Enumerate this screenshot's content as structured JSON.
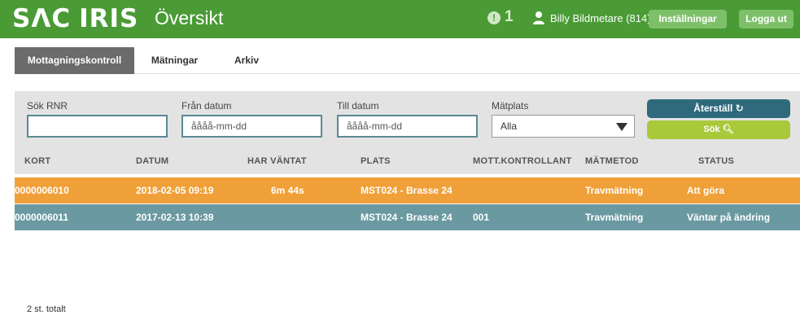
{
  "header": {
    "logo_left": "SΛC",
    "logo_right": "IRIS",
    "title": "Översikt",
    "alert_count": "1",
    "user_name": "Billy Bildmetare (814)",
    "settings_label": "Inställningar",
    "logout_label": "Logga ut",
    "colors": {
      "header_bg": "#4a9b36",
      "header_button": "#7ec06a"
    }
  },
  "tabs": [
    {
      "label": "Mottagningskontroll",
      "active": true
    },
    {
      "label": "Mätningar",
      "active": false
    },
    {
      "label": "Arkiv",
      "active": false
    }
  ],
  "filters": {
    "rnr_label": "Sök RNR",
    "rnr_value": "",
    "from_label": "Från datum",
    "from_placeholder": "åååå-mm-dd",
    "to_label": "Till datum",
    "to_placeholder": "åååå-mm-dd",
    "place_label": "Mätplats",
    "place_selected": "Alla",
    "reset_label": "Återställ ↻",
    "search_label": "Sök 🔍︎"
  },
  "table": {
    "columns": [
      "KORT",
      "DATUM",
      "HAR VÄNTAT",
      "PLATS",
      "MOTT.KONTROLLANT",
      "MÄTMETOD",
      "STATUS"
    ],
    "rows": [
      {
        "kort": "0000006010",
        "datum": "2018-02-05 09:19",
        "har_vantat": "6m 44s",
        "plats": "MST024 - Brasse 24",
        "mott_kontrollant": "",
        "matmetod": "Travmätning",
        "status": "Att göra",
        "color": "#f0a038"
      },
      {
        "kort": "0000006011",
        "datum": "2017-02-13 10:39",
        "har_vantat": "",
        "plats": "MST024 - Brasse 24",
        "mott_kontrollant": "001",
        "matmetod": "Travmätning",
        "status": "Väntar på ändring",
        "color": "#6a99a1"
      }
    ]
  },
  "footer": {
    "total": "2 st. totalt"
  }
}
